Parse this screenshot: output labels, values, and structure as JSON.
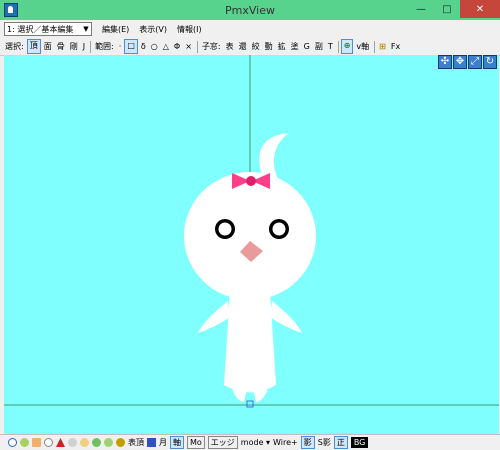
{
  "window": {
    "title": "PmxView",
    "minimize": "—",
    "maximize": "□",
    "close": "✕"
  },
  "menubar": {
    "combo_value": "1: 選択／基本編集",
    "items": [
      "編集(E)",
      "表示(V)",
      "情報(I)"
    ]
  },
  "toolbar": {
    "select_label": "選択:",
    "select_items": [
      "頂",
      "面",
      "骨",
      "剛",
      "J"
    ],
    "range_label": "範囲:",
    "range_items": [
      "·",
      "□",
      "δ",
      "○",
      "△",
      "Φ",
      "×"
    ],
    "child_label": "子窓:",
    "child_items": [
      "表",
      "還",
      "絞",
      "動",
      "拡",
      "塗",
      "G",
      "副",
      "T"
    ],
    "axis_label": "v軸",
    "fx_label": "Fx"
  },
  "navicons": [
    "move-icon",
    "pan-icon",
    "zoom-icon",
    "rotate-icon"
  ],
  "statusbar": {
    "items": [
      "表頂",
      "月",
      "軸",
      "Mo",
      "エッジ",
      "mode ▾",
      "Wire+",
      "影",
      "S影",
      "正",
      "BG"
    ]
  },
  "colors": {
    "viewport_bg": "#80ffff",
    "titlebar_bg": "#58d38e",
    "bow": "#ff3f8a",
    "beak": "#e99a9a"
  }
}
